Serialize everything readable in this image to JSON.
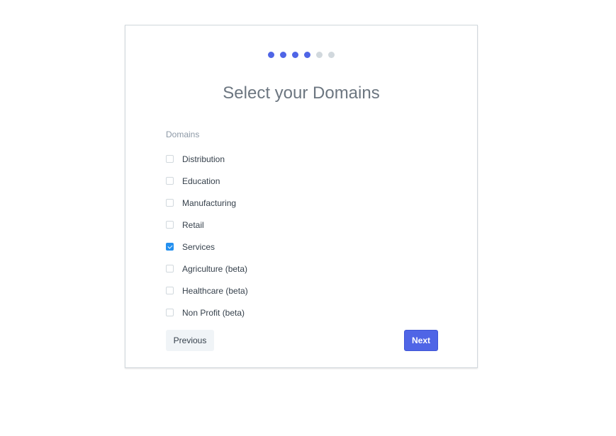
{
  "progress": {
    "total_steps": 6,
    "completed_steps": 4,
    "active_color": "#4f65e6",
    "inactive_color": "#d1d8dd"
  },
  "title": "Select your Domains",
  "field": {
    "label": "Domains",
    "options": [
      {
        "label": "Distribution",
        "checked": false
      },
      {
        "label": "Education",
        "checked": false
      },
      {
        "label": "Manufacturing",
        "checked": false
      },
      {
        "label": "Retail",
        "checked": false
      },
      {
        "label": "Services",
        "checked": true
      },
      {
        "label": "Agriculture (beta)",
        "checked": false
      },
      {
        "label": "Healthcare (beta)",
        "checked": false
      },
      {
        "label": "Non Profit (beta)",
        "checked": false
      }
    ]
  },
  "buttons": {
    "previous": "Previous",
    "next": "Next"
  }
}
